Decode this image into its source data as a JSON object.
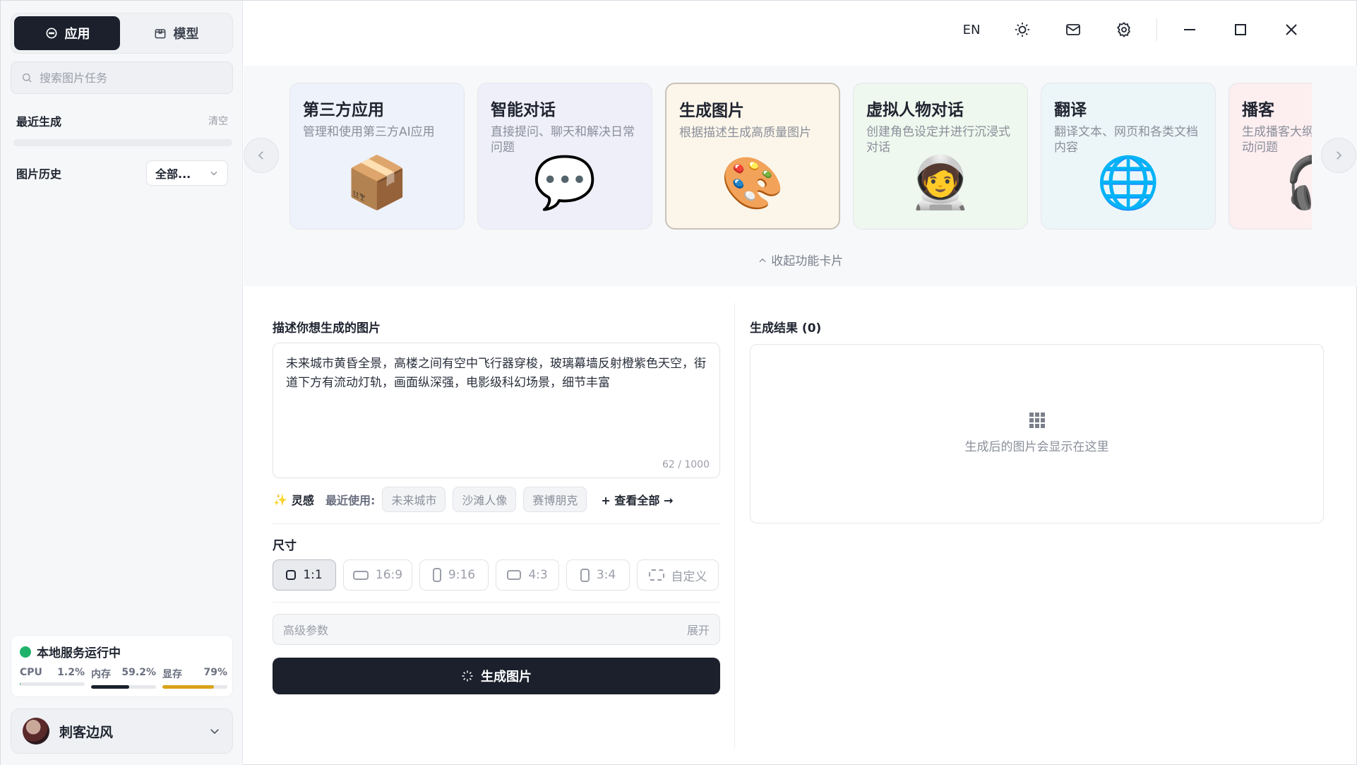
{
  "sidebar": {
    "tabs": {
      "app_label": "应用",
      "model_label": "模型"
    },
    "search_placeholder": "搜索图片任务",
    "recent": {
      "title": "最近生成",
      "clear_label": "清空"
    },
    "history": {
      "title": "图片历史",
      "filter_value": "全部..."
    },
    "status": {
      "title": "本地服务运行中",
      "status_color": "#21b26a",
      "metrics": [
        {
          "label": "CPU",
          "value": "1.2%",
          "percent": 1.2,
          "color": "#21b26a"
        },
        {
          "label": "内存",
          "value": "59.2%",
          "percent": 59.2,
          "color": "#1b202c"
        },
        {
          "label": "显存",
          "value": "79%",
          "percent": 79,
          "color": "#d9a21b"
        }
      ]
    },
    "user": {
      "name": "刺客边风"
    }
  },
  "topbar": {
    "lang_label": "EN",
    "icons": [
      "sun-icon",
      "mail-icon",
      "gear-icon",
      "minimize-icon",
      "maximize-icon",
      "close-icon"
    ]
  },
  "cards": [
    {
      "title": "第三方应用",
      "desc": "管理和使用第三方AI应用",
      "emoji": "📦",
      "bg": "#eef2fb"
    },
    {
      "title": "智能对话",
      "desc": "直接提问、聊天和解决日常问题",
      "emoji": "💬",
      "bg": "#efeffa"
    },
    {
      "title": "生成图片",
      "desc": "根据描述生成高质量图片",
      "emoji": "🎨",
      "bg": "#fcf6ea"
    },
    {
      "title": "虚拟人物对话",
      "desc": "创建角色设定并进行沉浸式对话",
      "emoji": "🧑‍🚀",
      "bg": "#eef8ee"
    },
    {
      "title": "翻译",
      "desc": "翻译文本、网页和各类文档内容",
      "emoji": "🌐",
      "bg": "#ecf6f8"
    },
    {
      "title": "播客",
      "desc": "生成播客大纲、主持稿和互动问题",
      "emoji": "🎧",
      "bg": "#fdeef0"
    }
  ],
  "collapse_label": "收起功能卡片",
  "prompt": {
    "label": "描述你想生成的图片",
    "text": "未来城市黄昏全景，高楼之间有空中飞行器穿梭，玻璃幕墙反射橙紫色天空，街道下方有流动灯轨，画面纵深强，电影级科幻场景，细节丰富",
    "count": "62 / 1000"
  },
  "inspiration": {
    "label": "灵感",
    "recent_label": "最近使用:",
    "chips": [
      "未来城市",
      "沙滩人像",
      "赛博朋克"
    ],
    "see_all": "+ 查看全部 →"
  },
  "size": {
    "label": "尺寸",
    "options": [
      {
        "label": "1:1",
        "active": true
      },
      {
        "label": "16:9",
        "active": false
      },
      {
        "label": "9:16",
        "active": false
      },
      {
        "label": "4:3",
        "active": false
      },
      {
        "label": "3:4",
        "active": false
      },
      {
        "label": "自定义",
        "active": false
      }
    ]
  },
  "advanced": {
    "label": "高级参数",
    "expand_label": "展开"
  },
  "generate_label": "生成图片",
  "result": {
    "title": "生成结果 (0)",
    "empty_text": "生成后的图片会显示在这里"
  }
}
